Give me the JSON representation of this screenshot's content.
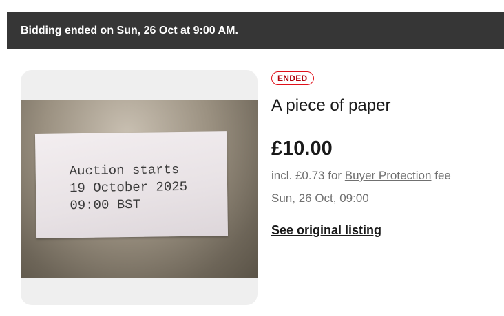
{
  "banner": {
    "text": "Bidding ended on Sun, 26 Oct at 9:00 AM."
  },
  "photo": {
    "line1": "Auction starts",
    "line2": "19 October 2025",
    "line3": "09:00 BST"
  },
  "listing": {
    "status_badge": "ENDED",
    "title": "A piece of paper",
    "price": "£10.00",
    "fee_prefix": "incl. £0.73 for",
    "fee_link": "Buyer Protection",
    "fee_suffix": "fee",
    "end_date": "Sun, 26 Oct, 09:00",
    "original_link": "See original listing"
  },
  "colors": {
    "banner_bg": "#363636",
    "badge_red": "#e0101a"
  }
}
